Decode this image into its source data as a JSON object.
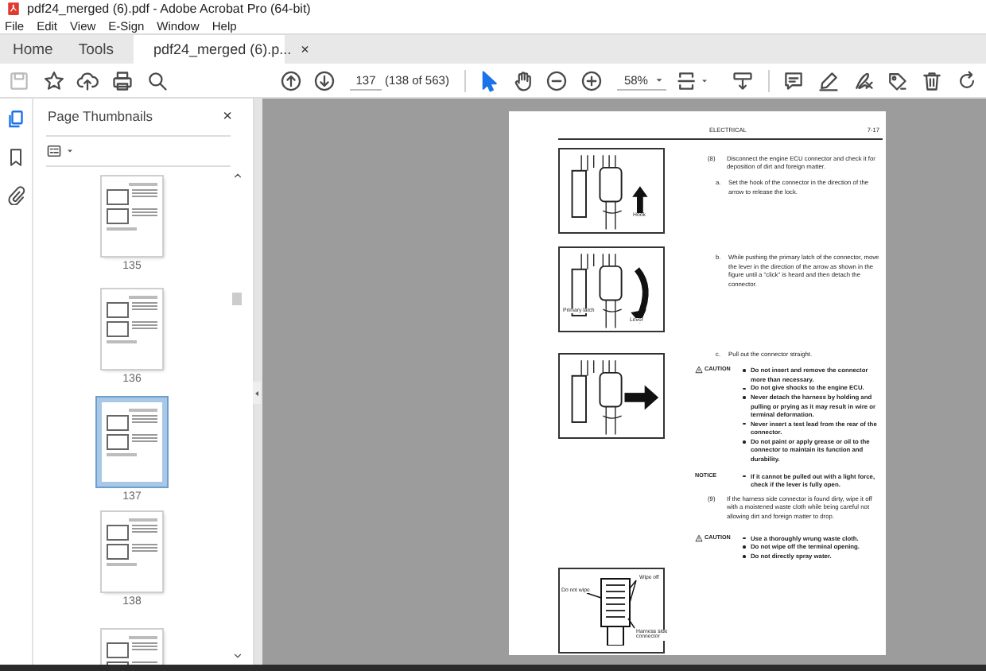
{
  "window": {
    "title": "pdf24_merged (6).pdf - Adobe Acrobat Pro (64-bit)"
  },
  "menu": [
    "File",
    "Edit",
    "View",
    "E-Sign",
    "Window",
    "Help"
  ],
  "tabs": [
    {
      "kind": "nav",
      "label": "Home",
      "selected": false
    },
    {
      "kind": "nav",
      "label": "Tools",
      "selected": false
    },
    {
      "kind": "document",
      "label": "pdf24_merged (6).p...",
      "close": "×",
      "selected": true
    }
  ],
  "toolbar": {
    "page_number": "137",
    "page_count": "(138 of 563)",
    "zoom": "58%"
  },
  "sidebar": {
    "title": "Page Thumbnails",
    "close": "×",
    "thumbnails": [
      {
        "label": "135",
        "selected": false
      },
      {
        "label": "136",
        "selected": false
      },
      {
        "label": "137",
        "selected": true
      },
      {
        "label": "138",
        "selected": false
      },
      {
        "selected": false
      }
    ]
  },
  "document": {
    "header": {
      "section": "ELECTRICAL",
      "page": "7-17"
    },
    "figures": [
      {
        "kind": "hook",
        "labels": [
          "Hook"
        ]
      },
      {
        "kind": "lever",
        "labels": [
          "Primary latch",
          "Lever"
        ]
      },
      {
        "kind": "pull"
      },
      {
        "kind": "wipe",
        "labels": [
          "Do not wipe",
          "Wipe off",
          "Harness side connector"
        ]
      }
    ],
    "blocks": [
      {
        "kind": "step",
        "number": "(8)",
        "text": "Disconnect the engine ECU connector and check it for deposition of dirt and foreign matter."
      },
      {
        "kind": "substep",
        "number": "a.",
        "text": "Set the hook of the connector in the direction of the arrow to release the lock."
      },
      {
        "kind": "substep",
        "number": "b.",
        "text": "While pushing the primary latch of the connector, move the lever in the direction of the arrow as shown in the figure until a \"click\" is heard and then detach the connector."
      },
      {
        "kind": "substep",
        "number": "c.",
        "text": "Pull out the connector straight."
      },
      {
        "kind": "caution",
        "label": "CAUTION",
        "items": [
          "Do not insert and remove the connector more than necessary.",
          "Do not give shocks to the engine ECU.",
          "Never detach the harness by holding and pulling or prying as it may result in wire or terminal deformation.",
          "Never insert a test lead from the rear of the connector.",
          "Do not paint or apply grease or oil to the connector to maintain its function and durability."
        ]
      },
      {
        "kind": "notice",
        "label": "NOTICE",
        "items": [
          "If it cannot be pulled out with a light force, check if the lever is fully open."
        ]
      },
      {
        "kind": "step",
        "number": "(9)",
        "text": "If the harness side connector is found dirty, wipe it off with a moistened waste cloth while being careful not allowing dirt and foreign matter to drop."
      },
      {
        "kind": "caution",
        "label": "CAUTION",
        "items": [
          "Use a thoroughly wrung waste cloth.",
          "Do not wipe off the terminal opening.",
          "Do not directly spray water."
        ]
      }
    ]
  }
}
